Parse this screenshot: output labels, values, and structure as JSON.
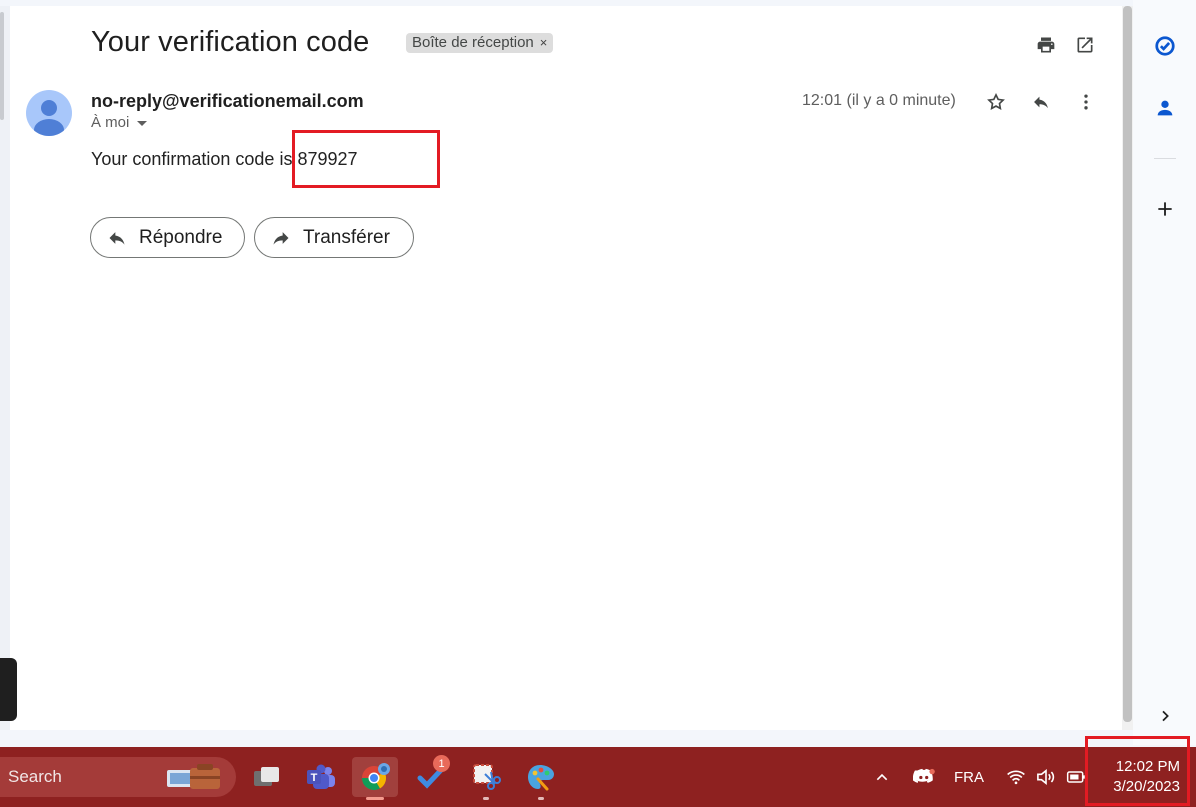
{
  "email": {
    "subject": "Your verification code",
    "label": "Boîte de réception",
    "label_remove": "×",
    "sender": "no-reply@verificationemail.com",
    "recipient": "À moi",
    "timestamp": "12:01 (il y a 0 minute)",
    "body": "Your confirmation code is 879927",
    "reply_label": "Répondre",
    "forward_label": "Transférer"
  },
  "icons": {
    "print": "print-icon",
    "open_new_window": "open-in-new-icon",
    "star": "star-icon",
    "reply": "reply-icon",
    "more": "more-vert-icon",
    "tasks": "tasks-icon",
    "contacts": "contacts-icon",
    "add": "plus-icon",
    "expand": "chevron-right-icon"
  },
  "taskbar": {
    "search_label": "Search",
    "badge_count": "1",
    "language": "FRA",
    "clock_time": "12:02 PM",
    "clock_date": "3/20/2023"
  },
  "colors": {
    "taskbar": "#8e2120",
    "highlight": "#e31b23",
    "accent_blue": "#0b57d0"
  }
}
